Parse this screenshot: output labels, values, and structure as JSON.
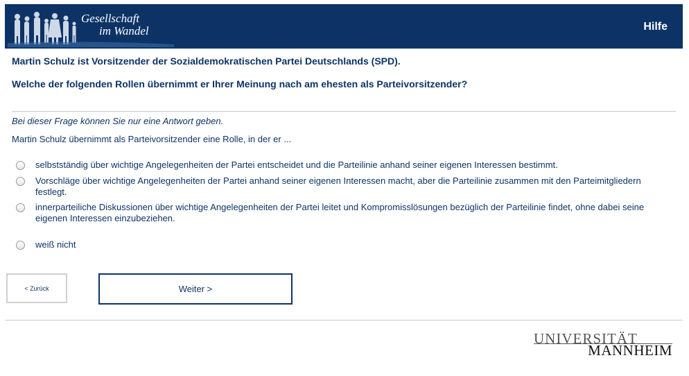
{
  "header": {
    "logo_line1": "Gesellschaft",
    "logo_line2": "im Wandel",
    "help_label": "Hilfe",
    "bg_color": "#0d3366"
  },
  "question": {
    "intro": "Martin Schulz ist Vorsitzender der Sozialdemokratischen Partei Deutschlands (SPD).",
    "title": "Welche der folgenden Rollen übernimmt er Ihrer Meinung nach am ehesten als Parteivorsitzender?",
    "hint": "Bei dieser Frage können Sie nur eine Antwort geben.",
    "stem": "Martin Schulz übernimmt als Parteivorsitzender eine Rolle, in der er ...",
    "options": [
      {
        "label": "selbstständig über wichtige Angelegenheiten der Partei entscheidet und die Parteilinie anhand seiner eigenen Interessen bestimmt."
      },
      {
        "label": "Vorschläge über wichtige Angelegenheiten der Partei anhand seiner eigenen Interessen macht, aber die Parteilinie zusammen mit den Parteimitgliedern festlegt."
      },
      {
        "label": "innerparteiliche Diskussionen über wichtige Angelegenheiten der Partei leitet und Kompromisslösungen bezüglich der Parteilinie findet, ohne dabei seine eigenen Interessen einzubeziehen."
      },
      {
        "label": "weiß nicht"
      }
    ]
  },
  "nav": {
    "back_label": "< Zurück",
    "next_label": "Weiter >"
  },
  "footer": {
    "uni_top": "UNIVERSITÄT",
    "uni_bottom": "MANNHEIM"
  }
}
